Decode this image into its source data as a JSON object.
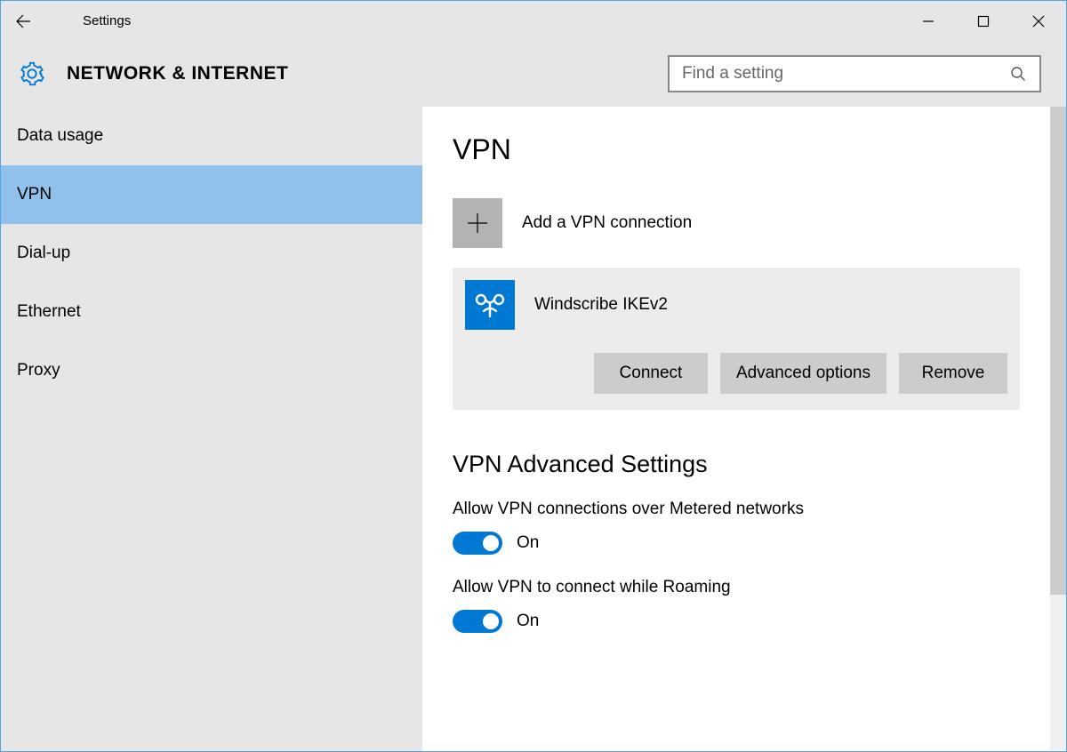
{
  "window": {
    "title": "Settings"
  },
  "header": {
    "category": "NETWORK & INTERNET"
  },
  "search": {
    "placeholder": "Find a setting"
  },
  "sidebar": {
    "items": [
      {
        "label": "Data usage"
      },
      {
        "label": "VPN"
      },
      {
        "label": "Dial-up"
      },
      {
        "label": "Ethernet"
      },
      {
        "label": "Proxy"
      }
    ]
  },
  "main": {
    "title": "VPN",
    "add_label": "Add a VPN connection",
    "connection": {
      "name": "Windscribe IKEv2",
      "buttons": {
        "connect": "Connect",
        "advanced": "Advanced options",
        "remove": "Remove"
      }
    },
    "advanced": {
      "title": "VPN Advanced Settings",
      "metered": {
        "label": "Allow VPN connections over Metered networks",
        "state": "On"
      },
      "roaming": {
        "label": "Allow VPN to connect while Roaming",
        "state": "On"
      }
    }
  },
  "colors": {
    "accent": "#0078d4",
    "selection": "#90c1ea",
    "chrome": "#e6e6e6"
  }
}
